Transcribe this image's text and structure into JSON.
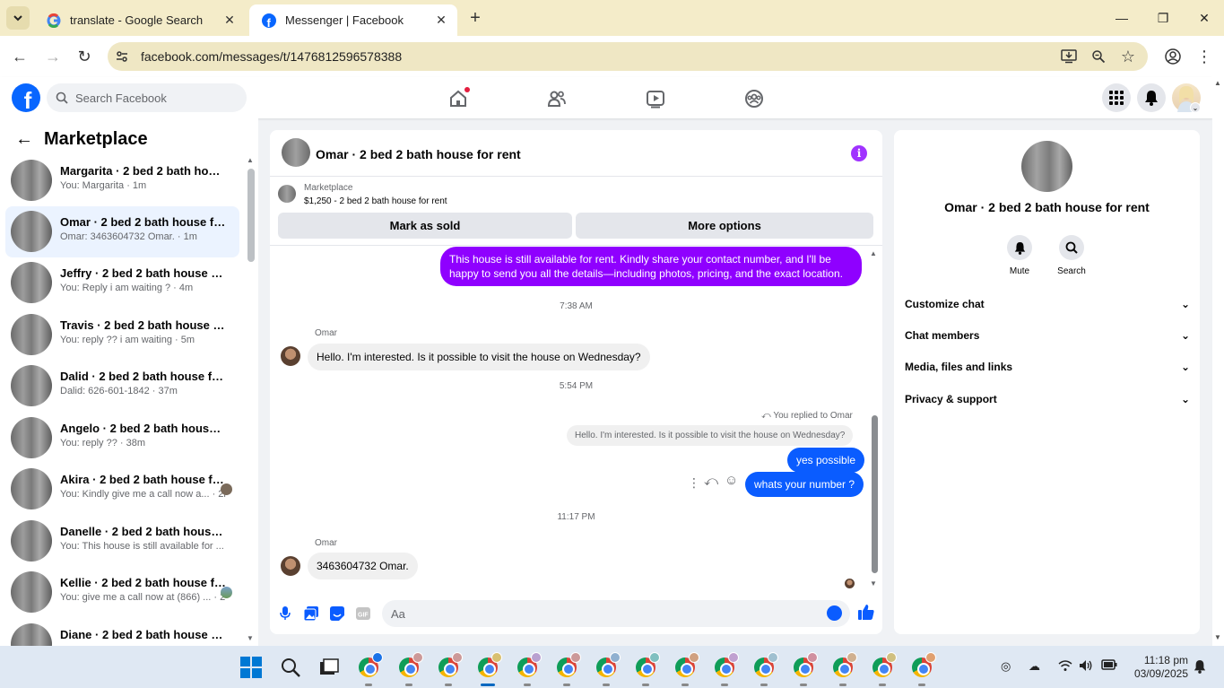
{
  "browser": {
    "tabs": [
      {
        "title": "translate - Google Search",
        "favicon": "google-icon"
      },
      {
        "title": "Messenger | Facebook",
        "favicon": "facebook-icon"
      }
    ],
    "url": "facebook.com/messages/t/1476812596578388"
  },
  "fb": {
    "search_placeholder": "Search Facebook"
  },
  "sidebar": {
    "title": "Marketplace",
    "conversations": [
      {
        "name": "Margarita · 2 bed 2 bath house ...",
        "snippet": "You: Margarita · 1m"
      },
      {
        "name": "Omar · 2 bed 2 bath house for r...",
        "snippet": "Omar: 3463604732 Omar. · 1m"
      },
      {
        "name": "Jeffry · 2 bed 2 bath house for r...",
        "snippet": "You: Reply i am waiting ? · 4m"
      },
      {
        "name": "Travis · 2 bed 2 bath house for r...",
        "snippet": "You: reply ?? i am waiting · 5m"
      },
      {
        "name": "Dalid · 2 bed 2 bath house for r...",
        "snippet": "Dalid: 626-601-1842 · 37m"
      },
      {
        "name": "Angelo · 2 bed 2 bath house for...",
        "snippet": "You: reply ?? · 38m"
      },
      {
        "name": "Akira · 2 bed 2 bath house fo...",
        "snippet": "You: Kindly give me a call now a... · 2h"
      },
      {
        "name": "Danelle · 2 bed 2 bath house fo...",
        "snippet": "You: This house is still available for ... · 2h"
      },
      {
        "name": "Kellie · 2 bed 2 bath house fo...",
        "snippet": "You: give me a call now at (866) ... · 2h"
      },
      {
        "name": "Diane · 2 bed 2 bath house for r...",
        "snippet": ""
      }
    ]
  },
  "chat": {
    "title": "Omar · 2 bed 2 bath house for rent",
    "listing_label": "Marketplace",
    "listing": "$1,250 - 2 bed 2 bath house for rent",
    "mark_sold": "Mark as sold",
    "more_options": "More options",
    "msg_out_1": "This house is still available for rent. Kindly share your contact number, and I'll be happy to send you all the details—including photos, pricing, and the exact location.",
    "time_1": "7:38 AM",
    "sender_1": "Omar",
    "msg_in_1": "Hello. I'm interested. Is it possible to visit the house on Wednesday?",
    "time_2": "5:54 PM",
    "replied_label": "You replied to Omar",
    "quoted": "Hello. I'm interested. Is it possible to visit the house on Wednesday?",
    "msg_out_2": "yes possible",
    "msg_out_3": "whats your number ?",
    "time_3": "11:17 PM",
    "sender_2": "Omar",
    "msg_in_2": "3463604732 Omar.",
    "composer_placeholder": "Aa"
  },
  "details": {
    "name": "Omar · 2 bed 2 bath house for rent",
    "mute": "Mute",
    "search": "Search",
    "sections": [
      "Customize chat",
      "Chat members",
      "Media, files and links",
      "Privacy & support"
    ]
  },
  "taskbar": {
    "time": "11:18 pm",
    "date": "03/09/2025"
  },
  "colors": {
    "messenger_purple": "#8f00ff",
    "messenger_blue": "#0a5cff",
    "fb_blue": "#0866ff",
    "selected_row": "#ebf3ff"
  }
}
